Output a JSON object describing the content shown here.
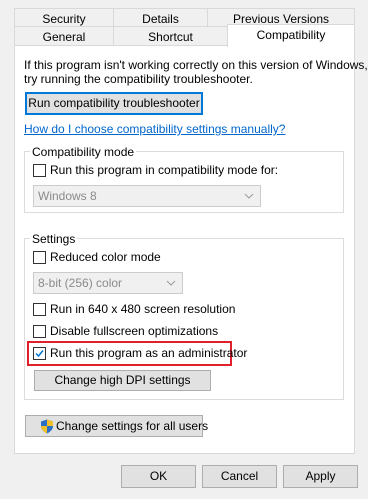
{
  "tabs_row1": [
    {
      "label": "Security"
    },
    {
      "label": "Details"
    },
    {
      "label": "Previous Versions"
    }
  ],
  "tabs_row2": [
    {
      "label": "General"
    },
    {
      "label": "Shortcut"
    },
    {
      "label": "Compatibility"
    }
  ],
  "intro": {
    "line1": "If this program isn't working correctly on this version of Windows,",
    "line2": "try running the compatibility troubleshooter."
  },
  "troubleshooter_button": "Run compatibility troubleshooter",
  "help_link": "How do I choose compatibility settings manually?",
  "compat_mode": {
    "group_label": "Compatibility mode",
    "checkbox_label": "Run this program in compatibility mode for:",
    "checked": false,
    "select_value": "Windows 8"
  },
  "settings": {
    "group_label": "Settings",
    "reduced_color_label": "Reduced color mode",
    "reduced_color_checked": false,
    "color_select_value": "8-bit (256) color",
    "resolution_label": "Run in 640 x 480 screen resolution",
    "resolution_checked": false,
    "fullscreen_label": "Disable fullscreen optimizations",
    "fullscreen_checked": false,
    "admin_label": "Run this program as an administrator",
    "admin_checked": true,
    "dpi_button": "Change high DPI settings"
  },
  "all_users_button": "Change settings for all users",
  "footer": {
    "ok": "OK",
    "cancel": "Cancel",
    "apply": "Apply"
  },
  "colors": {
    "highlight": "#e0202a",
    "link": "#0066cc",
    "check_blue": "#0078d7"
  }
}
